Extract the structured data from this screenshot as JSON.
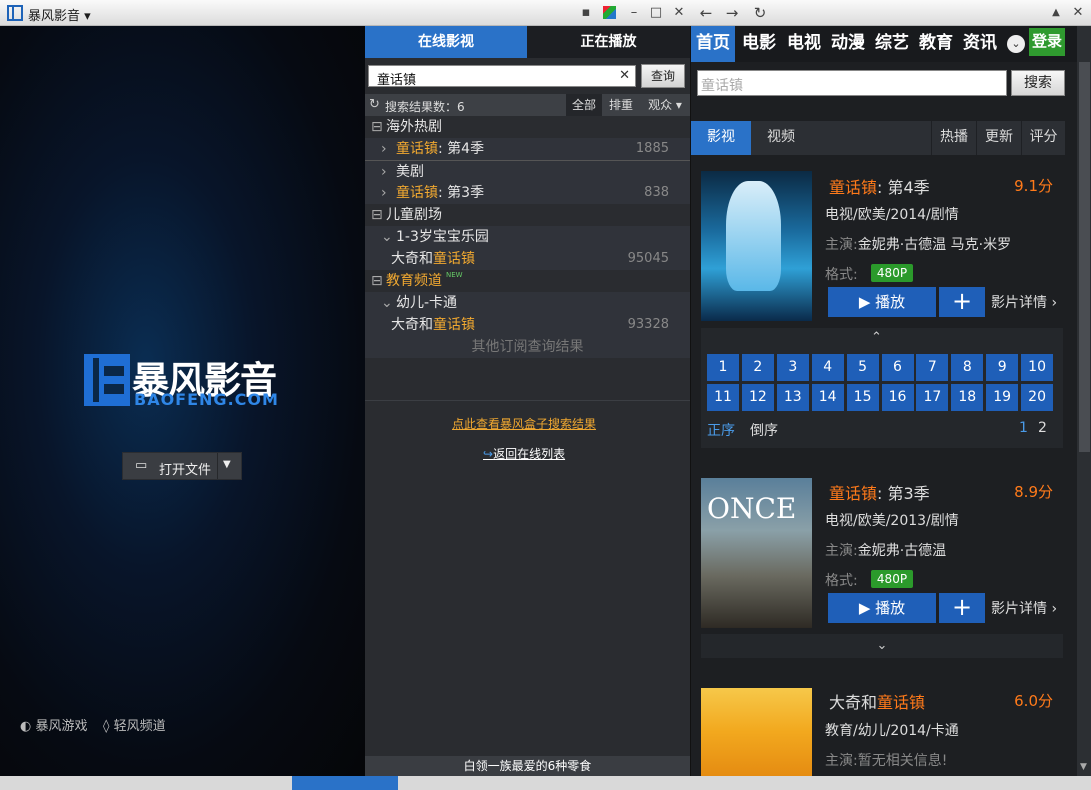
{
  "app": {
    "title": "暴风影音"
  },
  "title_icons": [
    "chat-icon",
    "skin-icon",
    "minimize-icon",
    "maximize-icon",
    "close-icon"
  ],
  "player": {
    "logo_cn": "暴风影音",
    "logo_en": "BAOFENG.COM",
    "open_file": "打开文件",
    "games": "暴风游戏",
    "light": "轻风频道"
  },
  "mid": {
    "tabs": [
      "在线影视",
      "正在播放"
    ],
    "search_value": "童话镇",
    "search_btn": "查询",
    "count_label": "搜索结果数：6",
    "filters": [
      "全部",
      "排重",
      "观众"
    ],
    "tree": [
      {
        "type": "group",
        "text": "海外热剧"
      },
      {
        "type": "item",
        "hl": "童话镇",
        "rest": ": 第4季",
        "num": "1885"
      },
      {
        "type": "item",
        "hl": "",
        "rest": "美剧",
        "num": ""
      },
      {
        "type": "item",
        "hl": "童话镇",
        "rest": ": 第3季",
        "num": "838"
      },
      {
        "type": "group",
        "text": "儿童剧场"
      },
      {
        "type": "sub",
        "text": "1-3岁宝宝乐园"
      },
      {
        "type": "leaf",
        "pre": "大奇和",
        "hl": "童话镇",
        "num": "95045"
      },
      {
        "type": "group2",
        "text": "教育频道",
        "badge": "NEW"
      },
      {
        "type": "sub",
        "text": "幼儿-卡通"
      },
      {
        "type": "leaf",
        "pre": "大奇和",
        "hl": "童话镇",
        "num": "93328"
      },
      {
        "type": "muted",
        "text": "其他订阅查询结果"
      }
    ],
    "notice": "点此查看暴风盒子搜索结果",
    "back": "返回在线列表",
    "ad": "白领一族最爱的6种零食"
  },
  "right": {
    "nav": [
      "首页",
      "电影",
      "电视",
      "动漫",
      "综艺",
      "教育",
      "资讯"
    ],
    "login": "登录",
    "search_placeholder": "童话镇",
    "search_btn": "搜索",
    "subtabs": [
      "影视",
      "视频"
    ],
    "sorts": [
      "热播",
      "更新",
      "评分"
    ],
    "cards": [
      {
        "hl": "童话镇",
        "rest": ": 第4季",
        "score": "9.1分",
        "meta": "电视/欧美/2014/剧情",
        "cast_label": "主演:",
        "cast": "金妮弗·古德温 马克·米罗",
        "fmt_label": "格式:",
        "fmt": "480P",
        "play": "播放",
        "detail": "影片详情"
      },
      {
        "hl": "童话镇",
        "rest": ": 第3季",
        "score": "8.9分",
        "meta": "电视/欧美/2013/剧情",
        "cast_label": "主演:",
        "cast": "金妮弗·古德温",
        "fmt_label": "格式:",
        "fmt": "480P",
        "play": "播放",
        "detail": "影片详情"
      },
      {
        "pre": "大奇和",
        "hl": "童话镇",
        "score": "6.0分",
        "meta": "教育/幼儿/2014/卡通",
        "cast_label": "主演:",
        "cast": "暂无相关信息!"
      }
    ],
    "episodes": [
      "1",
      "2",
      "3",
      "4",
      "5",
      "6",
      "7",
      "8",
      "9",
      "10",
      "11",
      "12",
      "13",
      "14",
      "15",
      "16",
      "17",
      "18",
      "19",
      "20"
    ],
    "order": [
      "正序",
      "倒序"
    ],
    "pages": [
      "1",
      "2"
    ]
  },
  "colors": {
    "accent": "#2a72c8",
    "highlight": "#f0a830",
    "score": "#ff7a1a",
    "badge": "#2b9a2b"
  }
}
